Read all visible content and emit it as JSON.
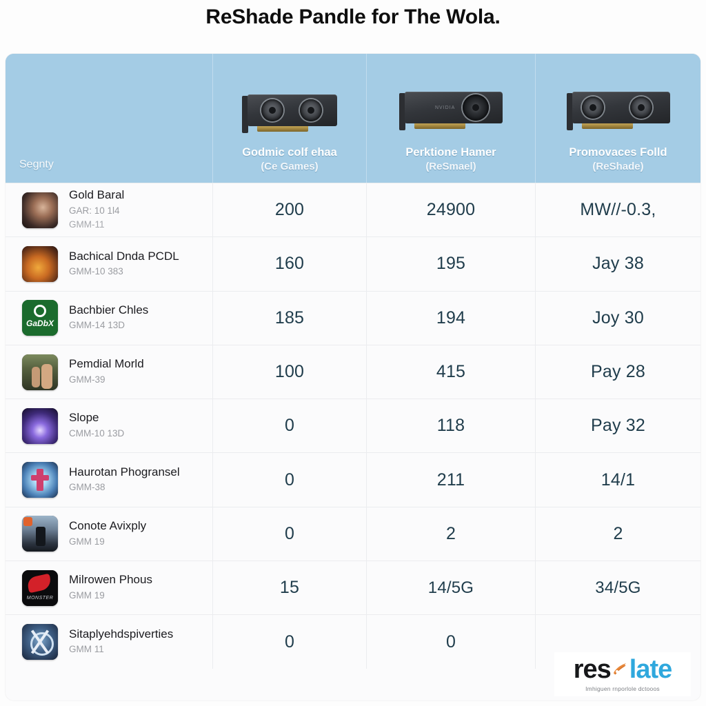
{
  "title": {
    "text": "ReShade Pandle for The Wola."
  },
  "table": {
    "columns": [
      {
        "key": "segnty",
        "title": "Segnty",
        "sub": "",
        "icon": ""
      },
      {
        "key": "godmic",
        "title": "Godmic colf ehaa",
        "sub": "(Ce Games)",
        "icon": "gpu-dual-fan"
      },
      {
        "key": "perktione",
        "title": "Perktione Hamer",
        "sub": "(ReSmael)",
        "icon": "gpu-blower"
      },
      {
        "key": "promovaces",
        "title": "Promovaces Folld",
        "sub": "(ReShade)",
        "icon": "gpu-twin-fan"
      }
    ],
    "rows": [
      {
        "name": "Gold Baral",
        "sub": "GAR: 10 1l4",
        "sub2": "GMM-11",
        "thumb": "portrait-woman-thumb",
        "values": [
          "200",
          "24900",
          "MW//-0.3,"
        ]
      },
      {
        "name": "Bachical Dnda PCDL",
        "sub": "GMM-10 383",
        "sub2": "",
        "thumb": "orange-character-thumb",
        "values": [
          "160",
          "195",
          "Jay 38"
        ]
      },
      {
        "name": "Bachbier Chles",
        "sub": "GMM-14 13D",
        "sub2": "",
        "thumb": "xbox-green-thumb",
        "values": [
          "185",
          "194",
          "Joy 30"
        ]
      },
      {
        "name": "Pemdial Morld",
        "sub": "GMM-39",
        "sub2": "",
        "thumb": "survival-duo-thumb",
        "values": [
          "100",
          "415",
          "Pay 28"
        ]
      },
      {
        "name": "Slope",
        "sub": "CMM-10 13D",
        "sub2": "",
        "thumb": "purple-energy-thumb",
        "values": [
          "0",
          "118",
          "Pay 32"
        ]
      },
      {
        "name": "Haurotan Phogransel",
        "sub": "GMM-38",
        "sub2": "",
        "thumb": "magic-circle-thumb",
        "values": [
          "0",
          "211",
          "14/1"
        ]
      },
      {
        "name": "Conote Avixply",
        "sub": "GMM 19",
        "sub2": "",
        "thumb": "knight-landscape-thumb",
        "values": [
          "0",
          "2",
          "2"
        ]
      },
      {
        "name": "Milrowen Phous",
        "sub": "GMM 19",
        "sub2": "",
        "thumb": "red-swoosh-thumb",
        "values": [
          "15",
          "14/5G",
          "34/5G"
        ]
      },
      {
        "name": "Sitaplyehdspiverties",
        "sub": "GMM 11",
        "sub2": "",
        "thumb": "blue-emblem-thumb",
        "values": [
          "0",
          "0",
          ""
        ]
      }
    ]
  },
  "logo": {
    "primary": "res",
    "secondary": "late",
    "tagline": "Imhiguen rnporlole dctooos",
    "mark": "orange-swirl-icon"
  },
  "colors": {
    "header_band": "#a4cce5",
    "value_text": "#1f3c4b",
    "row_bg": "#fbfbfc",
    "divider": "#ebecef",
    "logo_blue": "#2fa8dd",
    "logo_orange": "#e8883a"
  }
}
